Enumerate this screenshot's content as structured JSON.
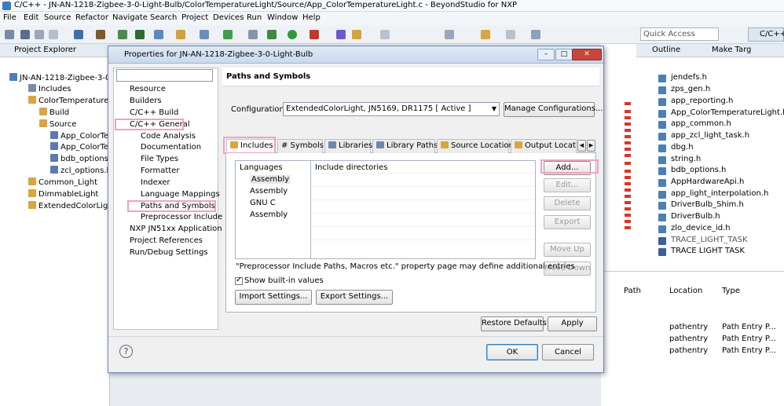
{
  "window": {
    "title": "C/C++ - JN-AN-1218-Zigbee-3-0-Light-Bulb/ColorTemperatureLight/Source/App_ColorTemperatureLight.c - BeyondStudio for NXP"
  },
  "menu": [
    "File",
    "Edit",
    "Source",
    "Refactor",
    "Navigate",
    "Search",
    "Project",
    "Devices",
    "Run",
    "Window",
    "Help"
  ],
  "toolbar": {
    "quick_access": "Quick Access",
    "perspective": "C/C++"
  },
  "project_explorer": {
    "title": "Project Explorer",
    "items": [
      "JN-AN-1218-Zigbee-3-0",
      "Includes",
      "ColorTemperatureLi",
      "Build",
      "Source",
      "App_ColorTer",
      "App_ColorTer",
      "bdb_options.",
      "zcl_options.h",
      "Common_Light",
      "DimmableLight",
      "ExtendedColorLight"
    ]
  },
  "outline": {
    "tab_outline": "Outline",
    "tab_make": "Make Targ",
    "items": [
      "jendefs.h",
      "zps_gen.h",
      "app_reporting.h",
      "App_ColorTemperatureLight.h",
      "app_common.h",
      "app_zcl_light_task.h",
      "dbg.h",
      "string.h",
      "bdb_options.h",
      "AppHardwareApi.h",
      "app_light_interpolation.h",
      "DriverBulb_Shim.h",
      "DriverBulb.h",
      "zlo_device_id.h",
      "TRACE_LIGHT_TASK",
      "TRACE LIGHT TASK"
    ]
  },
  "bottom_table": {
    "headers": [
      "Path",
      "Location",
      "Type"
    ],
    "rows": [
      [
        "pathentry",
        "Path Entry P..."
      ],
      [
        "pathentry",
        "Path Entry P..."
      ],
      [
        "pathentry",
        "Path Entry P..."
      ]
    ]
  },
  "dialog": {
    "title": "Properties for JN-AN-1218-Zigbee-3-0-Light-Bulb",
    "nav": [
      "Resource",
      "Builders",
      "C/C++ Build",
      "C/C++ General",
      "Code Analysis",
      "Documentation",
      "File Types",
      "Formatter",
      "Indexer",
      "Language Mappings",
      "Paths and Symbols",
      "Preprocessor Include",
      "NXP JN51xx Application",
      "Project References",
      "Run/Debug Settings"
    ],
    "page_title": "Paths and Symbols",
    "config_label": "Configuration:",
    "config_value": "ExtendedColorLight, JN5169, DR1175  [ Active ]",
    "manage_button": "Manage Configurations...",
    "tabs": [
      "Includes",
      "# Symbols",
      "Libraries",
      "Library Paths",
      "Source Location",
      "Output Locatio"
    ],
    "languages_header": "Languages",
    "include_header": "Include directories",
    "languages": [
      "Assembly",
      "Assembly",
      "GNU C",
      "Assembly"
    ],
    "side_buttons": [
      "Add...",
      "Edit...",
      "Delete",
      "Export",
      "Move Up",
      "Move Down"
    ],
    "note": "\"Preprocessor Include Paths, Macros etc.\" property page may define additional entries",
    "show_builtin": "Show built-in values",
    "import_button": "Import Settings...",
    "export_button": "Export Settings...",
    "restore_button": "Restore Defaults",
    "apply_button": "Apply",
    "ok_button": "OK",
    "cancel_button": "Cancel"
  }
}
